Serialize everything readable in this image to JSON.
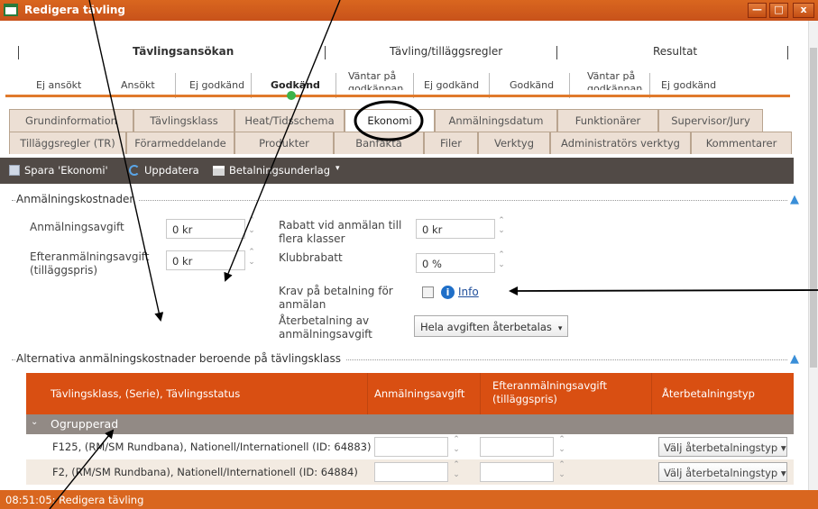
{
  "window": {
    "title": "Redigera tävling",
    "min_label": "—",
    "max_label": "□",
    "close_label": "x"
  },
  "steps": {
    "heads": [
      "Tävlingsansökan",
      "Tävling/tilläggsregler",
      "Resultat"
    ],
    "subs": [
      "Ej ansökt",
      "Ansökt",
      "Ej godkänd",
      "Godkänd",
      "Väntar på godkännande",
      "Ej godkänd",
      "Godkänd",
      "Väntar på godkännande",
      "Ej godkänd"
    ]
  },
  "tabs_row1": [
    "Grundinformation",
    "Tävlingsklass",
    "Heat/Tidsschema",
    "Ekonomi",
    "Anmälningsdatum",
    "Funktionärer",
    "Supervisor/Jury"
  ],
  "tabs_row2": [
    "Tilläggsregler (TR)",
    "Förarmeddelande",
    "Produkter",
    "Banfakta",
    "Filer",
    "Verktyg",
    "Administratörs verktyg",
    "Kommentarer"
  ],
  "toolbar": {
    "save": "Spara 'Ekonomi'",
    "refresh": "Uppdatera",
    "payment": "Betalningsunderlag",
    "more": "▾"
  },
  "costs": {
    "title": "Anmälningskostnader",
    "fee_label": "Anmälningsavgift",
    "fee_value": "0 kr",
    "late_fee_label": "Efteranmälningsavgift (tilläggspris)",
    "late_fee_value": "0 kr",
    "discount_label": "Rabatt vid anmälan till flera klasser",
    "discount_value": "0 kr",
    "club_discount_label": "Klubbrabatt",
    "club_discount_value": "0 %",
    "payment_required_label": "Krav på betalning för anmälan",
    "info_link": "Info",
    "refund_label": "Återbetalning av anmälningsavgift",
    "refund_value": "Hela avgiften återbetalas"
  },
  "alt_costs": {
    "title": "Alternativa anmälningskostnader beroende på tävlingsklass",
    "headers": [
      "Tävlingsklass, (Serie), Tävlingsstatus",
      "Anmälningsavgift",
      "Efteranmälningsavgift (tilläggspris)",
      "Återbetalningstyp"
    ],
    "group": "Ogrupperad",
    "rows": [
      {
        "name": "F125, (RM/SM Rundbana), Nationell/Internationell (ID: 64883)",
        "refund": "Välj återbetalningstyp"
      },
      {
        "name": "F2, (RM/SM Rundbana), Nationell/Internationell (ID: 64884)",
        "refund": "Välj återbetalningstyp"
      }
    ]
  },
  "status": {
    "text": "08:51:05: Redigera tävling"
  },
  "colors": {
    "accent": "#d9661f",
    "grid_header": "#d94f12",
    "toolbar": "#514a46",
    "link": "#1f4e9a"
  },
  "icons": {
    "arrow_up": "▲",
    "spin_up": "⌃",
    "spin_down": "⌄",
    "dropdown": "▾",
    "group_open": "⌄"
  }
}
